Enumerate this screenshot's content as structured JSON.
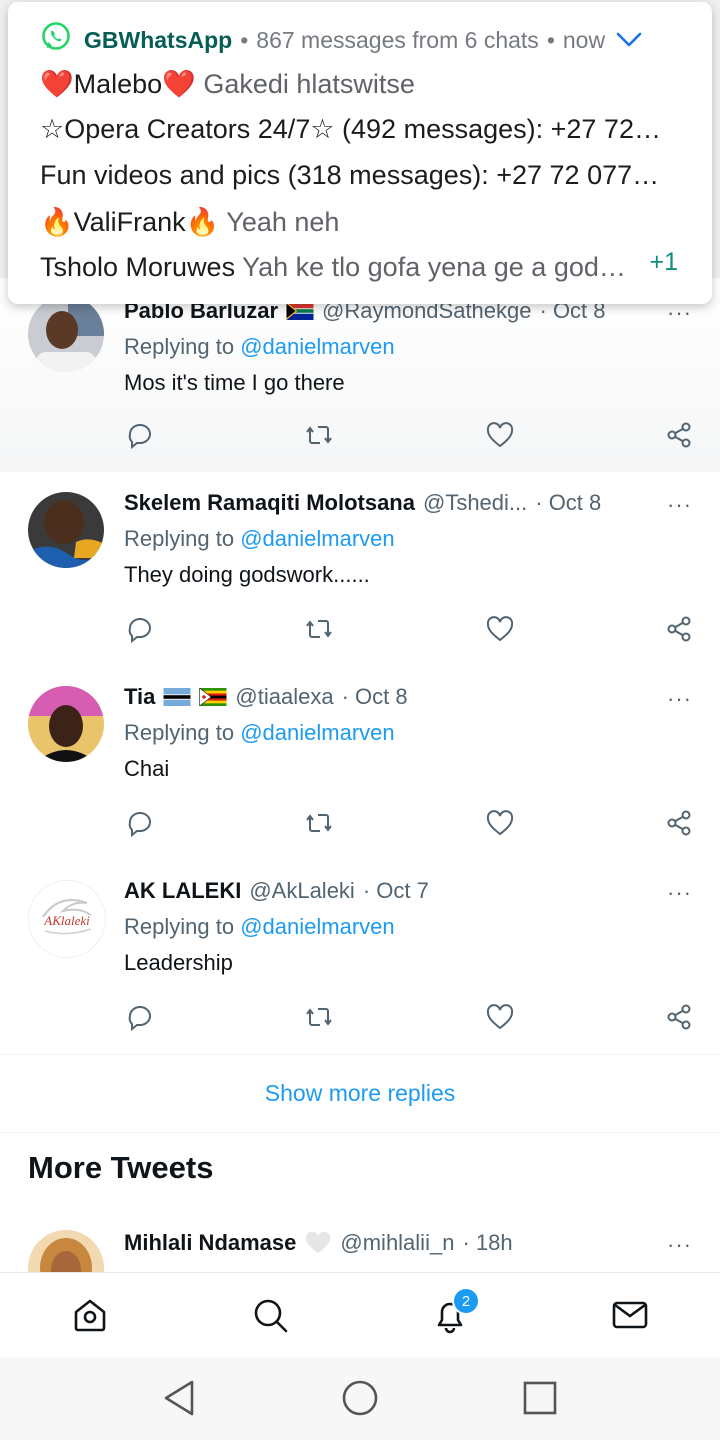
{
  "notification": {
    "app_name": "GBWhatsApp",
    "summary": "867 messages from 6 chats",
    "time": "now",
    "lines": [
      {
        "sender": "❤️Malebo❤️",
        "message": "Gakedi hlatswitse"
      },
      {
        "sender": "☆Opera Creators 24/7☆ (492 messages): +27 72…",
        "message": ""
      },
      {
        "sender": "Fun videos and pics (318 messages): +27 72 077…",
        "message": ""
      },
      {
        "sender": "🔥ValiFrank🔥",
        "message": "Yeah neh"
      },
      {
        "sender": "Tsholo Moruwes",
        "message": "Yah ke tlo gofa yena ge a god…"
      }
    ],
    "more_count": "+1"
  },
  "tweets": [
    {
      "name": "Pablo Barluzar",
      "handle": "@RaymondSathekge",
      "time": "· Oct 8",
      "reply_prefix": "Replying to",
      "reply_to": "@danielmarven",
      "text": "Mos it's time I go there"
    },
    {
      "name": "Skelem Ramaqiti Molotsana",
      "handle": "@Tshedi...",
      "time": "· Oct 8",
      "reply_prefix": "Replying to",
      "reply_to": "@danielmarven",
      "text": "They doing godswork......"
    },
    {
      "name": "Tia",
      "handle": "@tiaalexa",
      "time": "· Oct 8",
      "reply_prefix": "Replying to",
      "reply_to": "@danielmarven",
      "text": "Chai"
    },
    {
      "name": "AK LALEKI",
      "handle": "@AkLaleki",
      "time": "· Oct 7",
      "reply_prefix": "Replying to",
      "reply_to": "@danielmarven",
      "text": "Leadership",
      "avatar_text": "AKlaleki"
    }
  ],
  "show_more_label": "Show more replies",
  "more_tweets_heading": "More Tweets",
  "next_tweet": {
    "name": "Mihlali Ndamase",
    "handle": "@mihlalii_n",
    "time": "· 18h"
  },
  "more_icon": "···",
  "bottom_nav": {
    "notifications_badge": "2"
  },
  "colors": {
    "twitter_blue": "#1d9bf0",
    "whatsapp_green": "#075e54"
  }
}
